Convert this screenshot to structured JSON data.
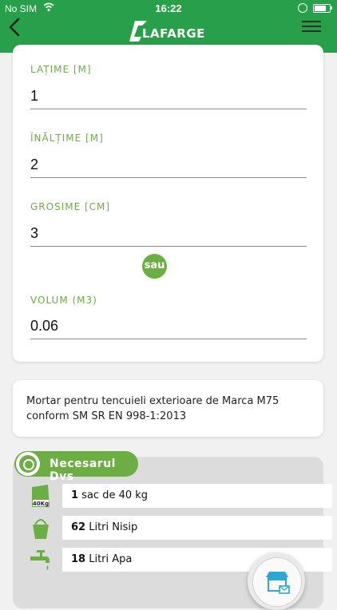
{
  "status": {
    "carrier": "No SIM",
    "time": "16:22"
  },
  "header": {
    "brand": "LAFARGE",
    "accent_color": "#28a04a"
  },
  "form": {
    "fields": [
      {
        "label": "LAȚIME [M]",
        "value": "1"
      },
      {
        "label": "ÎNĂLȚIME [M]",
        "value": "2"
      },
      {
        "label": "GROSIME [CM]",
        "value": "3"
      }
    ],
    "or_label": "sau",
    "volume": {
      "label": "VOLUM (M3)",
      "value": "0.06"
    },
    "label_color": "#6cae44"
  },
  "description": "Mortar pentru tencuieli exterioare de Marca M75 conform SM SR EN 998-1:2013",
  "needs": {
    "title": "Necesarul Dvs",
    "items": [
      {
        "icon": "cement-bag-icon",
        "icon_text": "40Kg",
        "amount": "1",
        "text": " sac de 40 kg"
      },
      {
        "icon": "bucket-icon",
        "amount": "62",
        "text": " Litri Nisip"
      },
      {
        "icon": "water-tap-icon",
        "amount": "18",
        "text": " Litri Apa"
      }
    ]
  },
  "shop_button": {
    "icon": "store-icon"
  }
}
